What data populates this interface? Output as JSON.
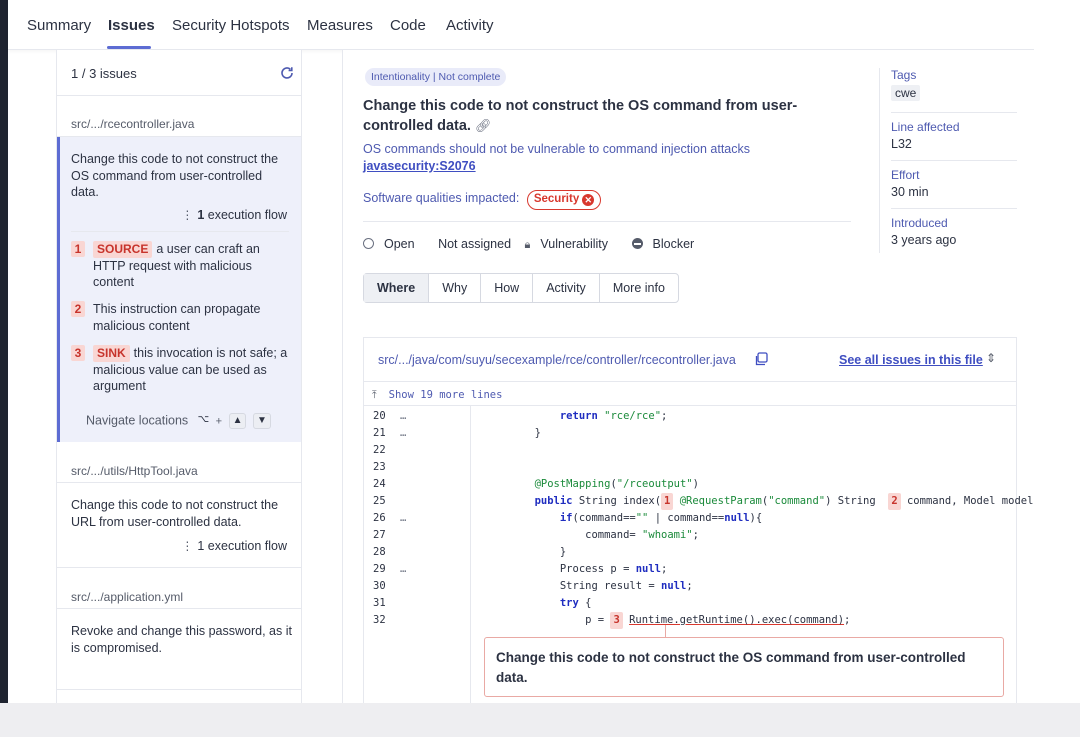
{
  "topnav": {
    "tabs": [
      "Summary",
      "Issues",
      "Security Hotspots",
      "Measures",
      "Code",
      "Activity"
    ],
    "active": "Issues"
  },
  "sidebar": {
    "count": "1 / 3 issues",
    "groups": [
      {
        "file": "src/.../rcecontroller.java",
        "issue": "Change this code to not construct the OS command from user-controlled data.",
        "flow_count": "1",
        "flow_label": "execution flow",
        "steps": [
          {
            "num": "1",
            "tag": "SOURCE",
            "text": "a user can craft an HTTP request with malicious content"
          },
          {
            "num": "2",
            "tag": "",
            "text": "This instruction can propagate malicious content"
          },
          {
            "num": "3",
            "tag": "SINK",
            "text": "this invocation is not safe; a malicious value can be used as argument"
          }
        ],
        "navigate": "Navigate locations",
        "kbd_option": "⌥",
        "kbd_plus": "+",
        "kbd_up": "▲",
        "kbd_down": "▼"
      },
      {
        "file": "src/.../utils/HttpTool.java",
        "issue": "Change this code to not construct the URL from user-controlled data.",
        "flow": "1 execution flow"
      },
      {
        "file": "src/.../application.yml",
        "issue": "Revoke and change this password, as it is compromised."
      }
    ]
  },
  "main": {
    "badge": "Intentionality | Not complete",
    "title": "Change this code to not construct the OS command from user-controlled data.",
    "rule_desc": "OS commands should not be vulnerable to command injection attacks",
    "rule_key": "javasecurity:S2076",
    "qualities_label": "Software qualities impacted:",
    "quality_badge": "Security",
    "status": {
      "open": "Open",
      "assignee": "Not assigned",
      "type": "Vulnerability",
      "severity": "Blocker"
    },
    "tabs": [
      "Where",
      "Why",
      "How",
      "Activity",
      "More info"
    ],
    "active_tab": "Where"
  },
  "meta": {
    "tags_label": "Tags",
    "tags_value": "cwe",
    "line_label": "Line affected",
    "line_value": "L32",
    "effort_label": "Effort",
    "effort_value": "30 min",
    "introduced_label": "Introduced",
    "introduced_value": "3 years ago"
  },
  "code": {
    "path": "src/.../java/com/suyu/secexample/rce/controller/rcecontroller.java",
    "see_all": "See all issues in this file",
    "show_more": "Show 19 more lines",
    "line_numbers": [
      "20",
      "21",
      "22",
      "23",
      "24",
      "25",
      "26",
      "27",
      "28",
      "29",
      "30",
      "31",
      "32"
    ],
    "ellipsis": "…",
    "message": "Change this code to not construct the OS command from user-controlled data."
  },
  "colors": {
    "accent": "#5d6cd3",
    "link": "#3f4ec1",
    "danger": "#d8382e",
    "marker_bg": "#f9d6d3"
  }
}
